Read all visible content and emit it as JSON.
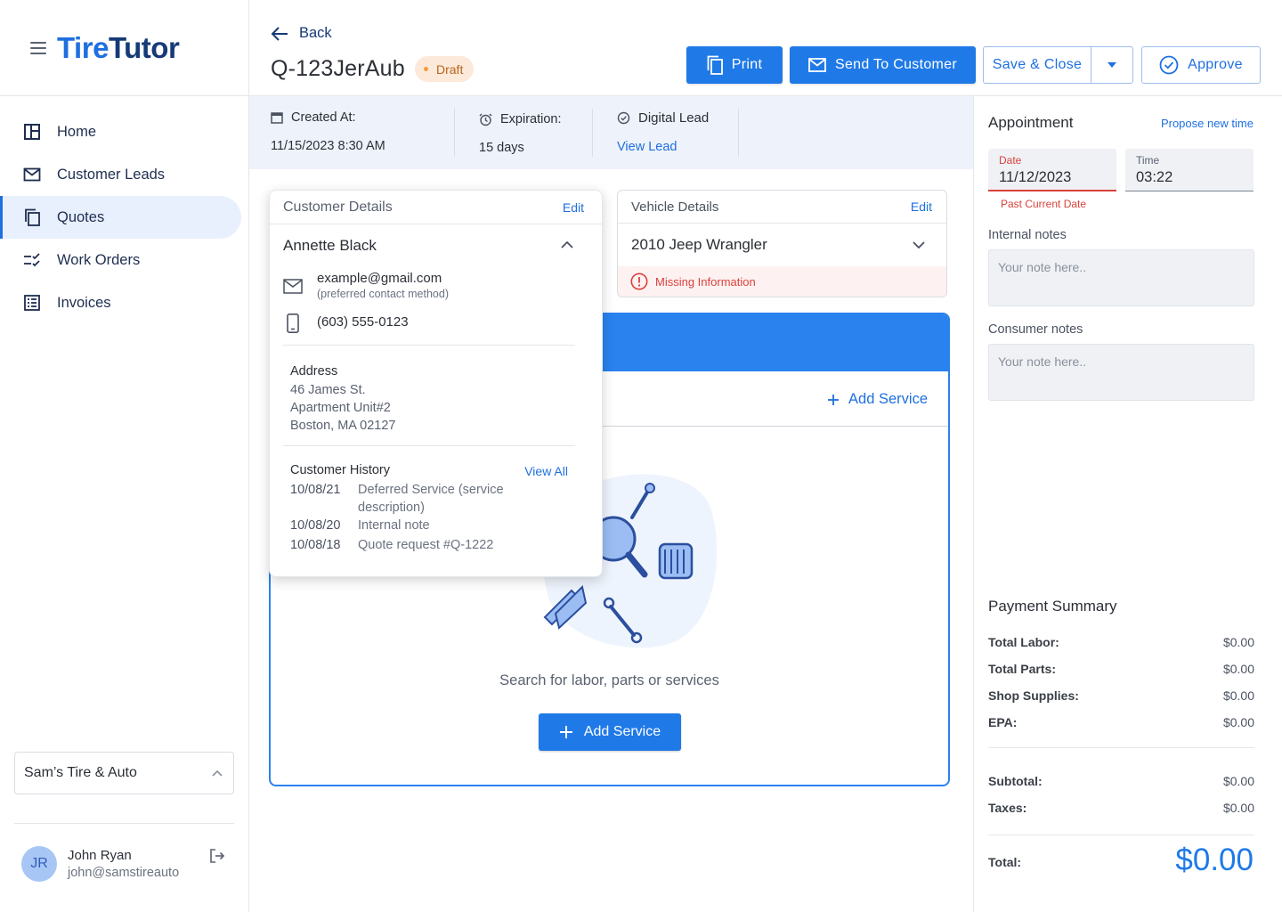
{
  "brand": {
    "logo_part1": "Tire",
    "logo_part2": "Tutor"
  },
  "sidebar": {
    "items": [
      {
        "label": "Home",
        "icon": "home-icon"
      },
      {
        "label": "Customer Leads",
        "icon": "mail-icon"
      },
      {
        "label": "Quotes",
        "icon": "copy-icon"
      },
      {
        "label": "Work Orders",
        "icon": "checklist-icon"
      },
      {
        "label": "Invoices",
        "icon": "invoice-icon"
      }
    ],
    "active_item": "Quotes",
    "shop_name": "Sam’s Tire & Auto",
    "user": {
      "initials": "JR",
      "name": "John Ryan",
      "email": "john@samstireauto"
    }
  },
  "header": {
    "back_label": "Back",
    "quote_id": "Q-123JerAub",
    "status": "Draft",
    "print_label": "Print",
    "send_label": "Send To Customer",
    "save_close_label": "Save & Close",
    "approve_label": "Approve"
  },
  "info": {
    "created_label": "Created At:",
    "created_value": "11/15/2023  8:30 AM",
    "expiration_label": "Expiration:",
    "expiration_value": "15 days",
    "lead_label": "Digital Lead",
    "lead_link": "View Lead"
  },
  "customer": {
    "title": "Customer Details",
    "edit_label": "Edit",
    "name": "Annette Black",
    "email": "example@gmail.com",
    "email_note": "(preferred contact method)",
    "phone": "(603) 555-0123",
    "address_title": "Address",
    "address_line1": "46 James St.",
    "address_line2": "Apartment Unit#2",
    "address_line3": "Boston, MA 02127",
    "history_title": "Customer History",
    "history_link": "View All",
    "history": [
      {
        "date": "10/08/21",
        "text": "Deferred Service (service description)"
      },
      {
        "date": "10/08/20",
        "text": "Internal note"
      },
      {
        "date": "10/08/18",
        "text": "Quote request #Q-1222"
      }
    ]
  },
  "vehicle": {
    "title": "Vehicle Details",
    "edit_label": "Edit",
    "name": "2010 Jeep Wrangler",
    "warning": "Missing Information"
  },
  "services": {
    "add_link": "Add Service",
    "empty_text": "Search for labor, parts or services",
    "add_button": "Add Service"
  },
  "appointment": {
    "title": "Appointment",
    "propose_link": "Propose new time",
    "date_label": "Date",
    "date_value": "11/12/2023",
    "date_error": "Past Current Date",
    "time_label": "Time",
    "time_value": "03:22",
    "internal_notes_label": "Internal notes",
    "internal_notes_placeholder": "Your note here..",
    "consumer_notes_label": "Consumer notes",
    "consumer_notes_placeholder": "Your note here.."
  },
  "payment": {
    "title": "Payment Summary",
    "rows": [
      {
        "label": "Total Labor:",
        "value": "$0.00"
      },
      {
        "label": "Total Parts:",
        "value": "$0.00"
      },
      {
        "label": "Shop Supplies:",
        "value": "$0.00"
      },
      {
        "label": "EPA:",
        "value": "$0.00"
      }
    ],
    "subtotal_label": "Subtotal:",
    "subtotal_value": "$0.00",
    "taxes_label": "Taxes:",
    "taxes_value": "$0.00",
    "total_label": "Total:",
    "total_value": "$0.00"
  },
  "colors": {
    "primary": "#1f7ae8",
    "brand_dark": "#163a77",
    "error": "#d9423b",
    "draft_badge": "#fde9da"
  }
}
